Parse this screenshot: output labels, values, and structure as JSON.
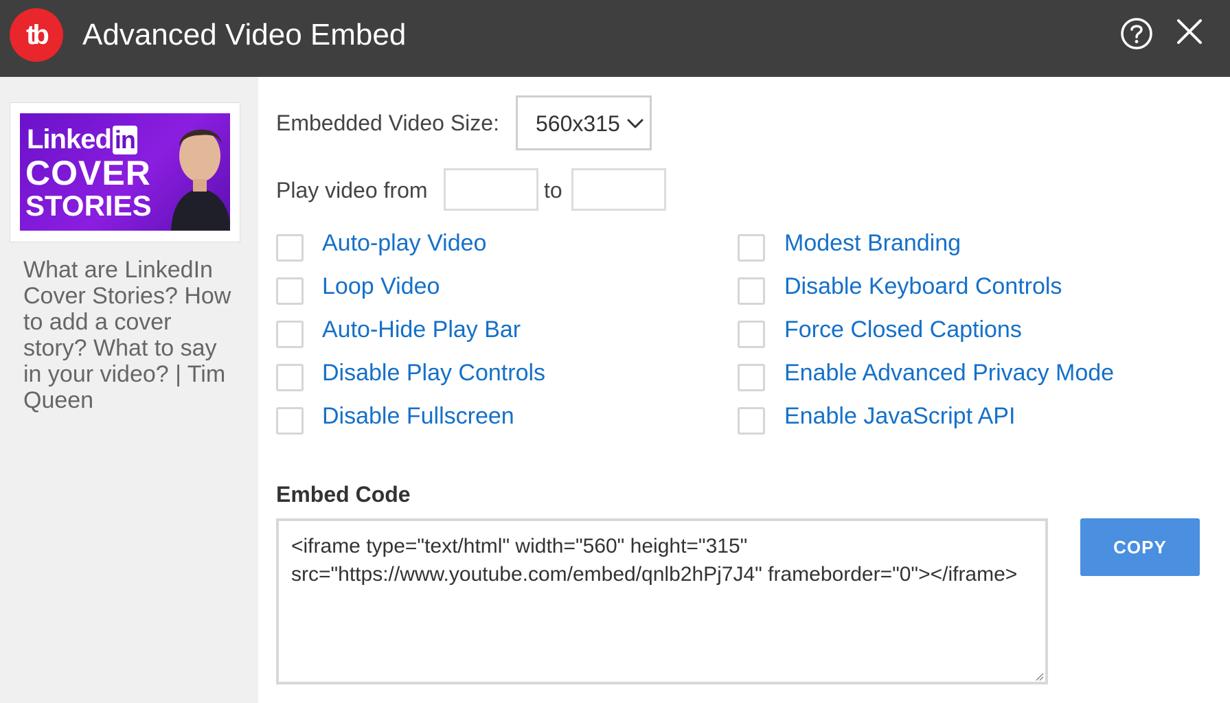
{
  "header": {
    "logo_text": "tb",
    "title": "Advanced Video Embed"
  },
  "sidebar": {
    "thumbnail": {
      "linked": "Linked",
      "in": "in",
      "line2": "COVER",
      "line3": "STORIES"
    },
    "description": "What are LinkedIn Cover Stories? How to add a cover story? What to say in your video? | Tim Queen"
  },
  "size": {
    "label": "Embedded Video Size:",
    "selected": "560x315"
  },
  "play_range": {
    "from_label": "Play video from",
    "to_label": "to",
    "from_value": "",
    "to_value": ""
  },
  "options_left": [
    {
      "label": "Auto-play Video",
      "checked": false
    },
    {
      "label": "Loop Video",
      "checked": false
    },
    {
      "label": "Auto-Hide Play Bar",
      "checked": false
    },
    {
      "label": "Disable Play Controls",
      "checked": false
    },
    {
      "label": "Disable Fullscreen",
      "checked": false
    }
  ],
  "options_right": [
    {
      "label": "Modest Branding",
      "checked": false
    },
    {
      "label": "Disable Keyboard Controls",
      "checked": false
    },
    {
      "label": "Force Closed Captions",
      "checked": false
    },
    {
      "label": "Enable Advanced Privacy Mode",
      "checked": false
    },
    {
      "label": "Enable JavaScript API",
      "checked": false
    }
  ],
  "embed": {
    "title": "Embed Code",
    "code": "<iframe type=\"text/html\" width=\"560\" height=\"315\" src=\"https://www.youtube.com/embed/qnlb2hPj7J4\" frameborder=\"0\"></iframe>",
    "copy_label": "COPY"
  },
  "colors": {
    "header_bg": "#3f3f3f",
    "logo_red": "#e8262b",
    "link_blue": "#1570c8",
    "copy_blue": "#4a8fe0",
    "sidebar_bg": "#f0f0f0",
    "thumb_purple": "#7a18d6"
  },
  "icons": {
    "help": "question-circle-icon",
    "close": "close-icon",
    "select": "chevron-down-icon",
    "resize": "resize-handle-icon"
  }
}
